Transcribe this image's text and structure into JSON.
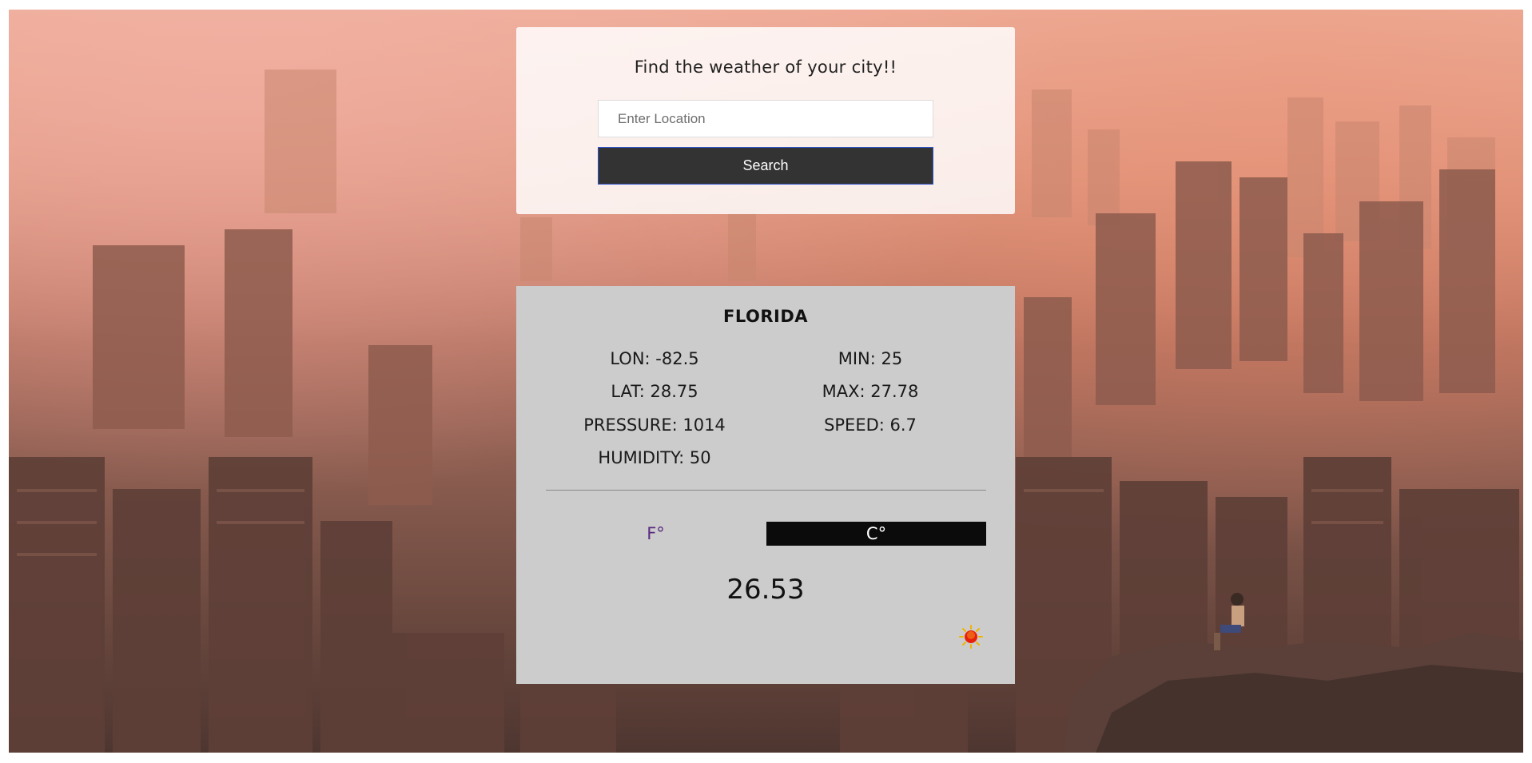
{
  "search": {
    "title": "Find the weather of your city!!",
    "placeholder": "Enter Location",
    "value": "",
    "button_label": "Search"
  },
  "weather": {
    "city": "FLORIDA",
    "stats_left": [
      {
        "label": "LON",
        "value": "-82.5",
        "text": "LON: -82.5"
      },
      {
        "label": "LAT",
        "value": "28.75",
        "text": "LAT: 28.75"
      },
      {
        "label": "PRESSURE",
        "value": "1014",
        "text": "PRESSURE: 1014"
      },
      {
        "label": "HUMIDITY",
        "value": "50",
        "text": "HUMIDITY: 50"
      }
    ],
    "stats_right": [
      {
        "label": "MIN",
        "value": "25",
        "text": "MIN: 25"
      },
      {
        "label": "MAX",
        "value": "27.78",
        "text": "MAX: 27.78"
      },
      {
        "label": "SPEED",
        "value": "6.7",
        "text": "SPEED: 6.7"
      }
    ],
    "unit_fahrenheit": "F°",
    "unit_celsius": "C°",
    "active_unit": "C",
    "temperature": "26.53",
    "condition_icon": "sun-icon"
  },
  "colors": {
    "search_button_bg": "#333333",
    "weather_card_bg": "#cccccc",
    "active_unit_bg": "#0b0b0b",
    "inactive_unit_text": "#5a2a80",
    "sun": "#f1c40f"
  }
}
